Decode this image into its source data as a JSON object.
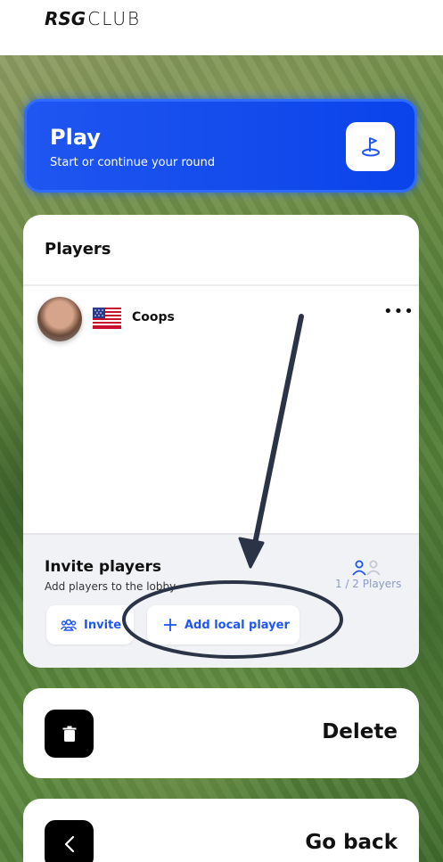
{
  "header": {
    "logo_rsg": "RSG",
    "logo_club": "CLUB"
  },
  "play": {
    "title": "Play",
    "subtitle": "Start or continue your round",
    "icon": "golf-hole-flag-icon"
  },
  "players": {
    "title": "Players",
    "list": [
      {
        "name": "Coops",
        "flag": "united-states-flag"
      }
    ]
  },
  "invite": {
    "title": "Invite players",
    "subtitle": "Add players to the lobby",
    "count": "1 / 2 Players",
    "invite_label": "Invite",
    "add_local_label": "Add local player"
  },
  "actions": {
    "delete_label": "Delete",
    "go_back_label": "Go back"
  },
  "colors": {
    "accent": "#1f56f0",
    "annotation": "#2b3447"
  }
}
